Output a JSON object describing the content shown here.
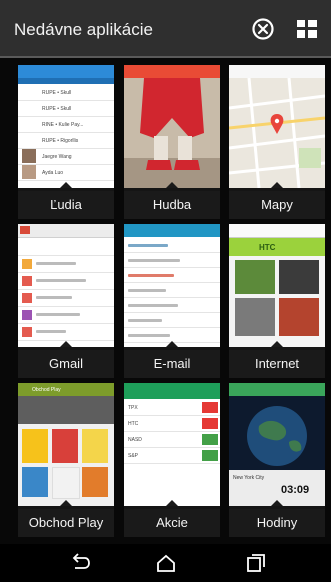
{
  "header": {
    "title": "Nedávne aplikácie",
    "close_icon": "close-all-icon",
    "grid_icon": "grid-view-icon"
  },
  "apps": [
    {
      "label": "Ľudia",
      "accent": "#2d8bd8",
      "rows": [
        "RUPE • Skull",
        "RUPE • Skull",
        "RINE • Kulie Pay...",
        "RUPE • Rigorllis",
        "Jaegre Wang",
        "Ayda Luo"
      ]
    },
    {
      "label": "Hudba",
      "accent": "#e94b35"
    },
    {
      "label": "Mapy",
      "accent": "#e9e5dc"
    },
    {
      "label": "Gmail",
      "accent": "#d84a38"
    },
    {
      "label": "E-mail",
      "accent": "#2196c4"
    },
    {
      "label": "Internet",
      "accent": "#2b8a3e",
      "page_text": "HTC"
    },
    {
      "label": "Obchod Play",
      "accent": "#7d9c2b",
      "store_title": "Obchod Play"
    },
    {
      "label": "Akcie",
      "accent": "#1e9f5a",
      "stocks": [
        "TPX",
        "HTC",
        "NASD",
        "S&P"
      ]
    },
    {
      "label": "Hodiny",
      "accent": "#3aa55a",
      "city": "New York City",
      "time": "03:09"
    }
  ],
  "navbar": {
    "back_icon": "back-icon",
    "home_icon": "home-icon",
    "recents_icon": "recents-icon"
  }
}
